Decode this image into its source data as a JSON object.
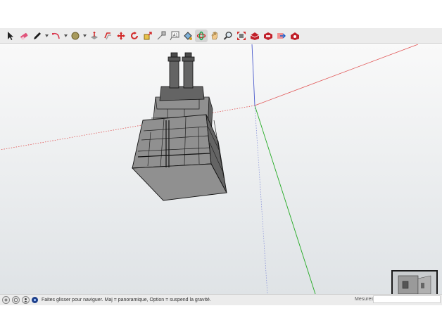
{
  "toolbar": {
    "tools": [
      {
        "name": "select-tool-icon",
        "color": "#222222"
      },
      {
        "name": "eraser-tool-icon",
        "color": "#e0527a"
      },
      {
        "name": "pencil-line-tool-icon",
        "color": "#1a1a1a"
      },
      {
        "name": "arc-tool-icon",
        "color": "#d9344b"
      },
      {
        "name": "shape-tool-icon",
        "color": "#8c7b3e"
      },
      {
        "name": "push-pull-tool-icon",
        "color": "#5a5a5a"
      },
      {
        "name": "offset-tool-icon",
        "color": "#d22a2a"
      },
      {
        "name": "move-tool-icon",
        "color": "#d22a2a"
      },
      {
        "name": "rotate-tool-icon",
        "color": "#d22a2a"
      },
      {
        "name": "scale-tool-icon",
        "color": "#d22a2a"
      },
      {
        "name": "tape-measure-tool-icon",
        "color": "#8a8a8a"
      },
      {
        "name": "text-tool-icon",
        "color": "#555555"
      },
      {
        "name": "paint-bucket-tool-icon",
        "color": "#d2a02a"
      },
      {
        "name": "orbit-tool-icon",
        "color": "#d22a2a"
      },
      {
        "name": "pan-tool-icon",
        "color": "#e0b070"
      },
      {
        "name": "zoom-tool-icon",
        "color": "#3a3a3a"
      },
      {
        "name": "zoom-extents-tool-icon",
        "color": "#d22a2a"
      },
      {
        "name": "3d-warehouse-icon",
        "color": "#c0202a"
      },
      {
        "name": "extension-warehouse-icon",
        "color": "#c0202a"
      },
      {
        "name": "send-to-layout-icon",
        "color": "#c0202a"
      },
      {
        "name": "extension-manager-icon",
        "color": "#c0202a"
      }
    ]
  },
  "status": {
    "hint": "Faites glisser pour naviguer. Maj = panoramique, Option =  suspend la gravité.",
    "measures_label": "Mesures",
    "measures_value": ""
  },
  "colors": {
    "axis_red": "#e05050",
    "axis_green": "#22aa22",
    "axis_blue": "#4a5acc",
    "model_fill": "#8a8a8a"
  }
}
